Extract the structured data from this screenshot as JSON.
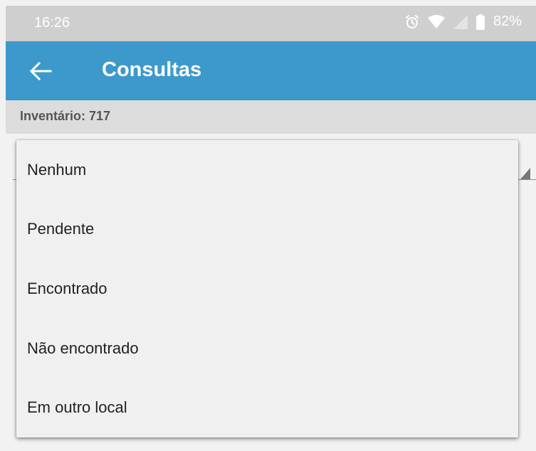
{
  "status_bar": {
    "time": "16:26",
    "battery": "82%",
    "icons": [
      "alarm-icon",
      "wifi-icon",
      "signal-icon",
      "battery-icon"
    ]
  },
  "app_bar": {
    "title": "Consultas",
    "back_icon": "back-arrow-icon",
    "color": "#3d99cc"
  },
  "info": {
    "label": "Inventário: 717"
  },
  "dropdown": {
    "items": [
      {
        "label": "Nenhum"
      },
      {
        "label": "Pendente"
      },
      {
        "label": "Encontrado"
      },
      {
        "label": "Não encontrado"
      },
      {
        "label": "Em outro local"
      }
    ]
  }
}
